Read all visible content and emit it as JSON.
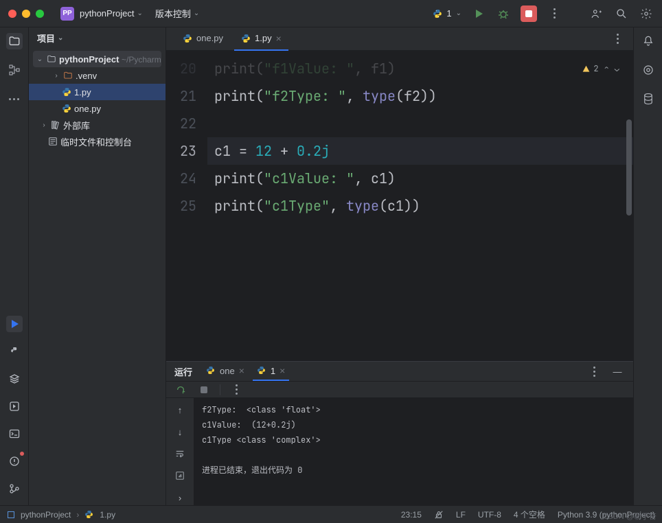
{
  "titlebar": {
    "project": "pythonProject",
    "vc": "版本控制",
    "runconfig": "1"
  },
  "project_panel": {
    "title": "项目",
    "root_name": "pythonProject",
    "root_path": "~/Pycharm",
    "venv": ".venv",
    "file1": "1.py",
    "file2": "one.py",
    "ext_lib": "外部库",
    "scratches": "临时文件和控制台"
  },
  "tabs": {
    "t1": "one.py",
    "t2": "1.py"
  },
  "editor_badge": {
    "warnings": "2"
  },
  "gutter": {
    "l20": "20",
    "l21": "21",
    "l22": "22",
    "l23": "23",
    "l24": "24",
    "l25": "25"
  },
  "code": {
    "l21_fn": "print",
    "l21_str": "\"f2Type: \"",
    "l21_type": "type",
    "l21_arg": "f2",
    "l23_v": "c1",
    "l23_eq": " = ",
    "l23_n1": "12",
    "l23_plus": " + ",
    "l23_n2": "0.2j",
    "l24_fn": "print",
    "l24_str": "\"c1Value: \"",
    "l24_arg": "c1",
    "l25_fn": "print",
    "l25_str": "\"c1Type\"",
    "l25_type": "type",
    "l25_arg": "c1"
  },
  "run": {
    "title": "运行",
    "tab1": "one",
    "tab2": "1"
  },
  "console": {
    "l1": "f2Type:  <class 'float'>",
    "l2": "c1Value:  (12+0.2j)",
    "l3": "c1Type <class 'complex'>",
    "l4": "",
    "l5": "进程已结束，退出代码为 0"
  },
  "status": {
    "project": "pythonProject",
    "file": "1.py",
    "pos": "23:15",
    "le": "LF",
    "enc": "UTF-8",
    "indent": "4 个空格",
    "interpreter": "Python 3.9 (pythonProject)",
    "watermark": "CSDN @勒于奋"
  }
}
